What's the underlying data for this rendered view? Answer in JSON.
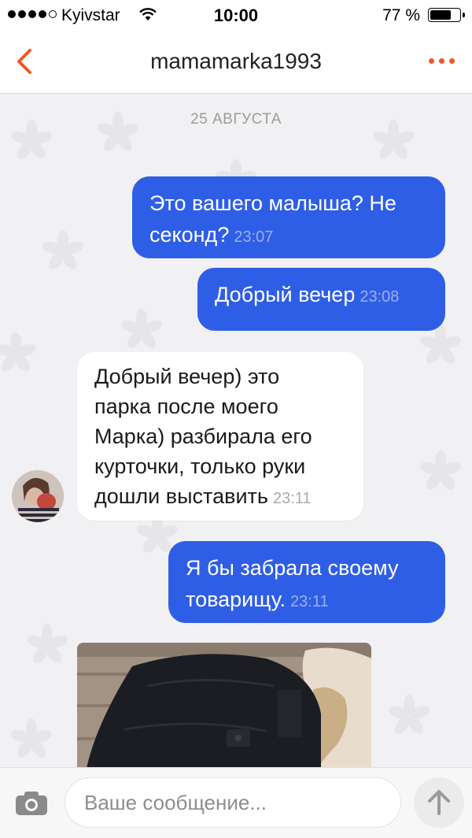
{
  "status_bar": {
    "carrier": "Kyivstar",
    "time": "10:00",
    "battery_percent": "77 %",
    "battery_level": 0.77
  },
  "header": {
    "title": "mamamarka1993",
    "back_icon": "chevron-left-icon",
    "more_icon": "more-dots-icon",
    "accent_color": "#f05a22"
  },
  "chat": {
    "date_separator": "25 АВГУСТА",
    "messages": [
      {
        "direction": "out",
        "lines": [
          "Это вашего малыша? Не",
          "секонд?"
        ],
        "time": "23:07"
      },
      {
        "direction": "out",
        "lines": [
          "Добрый вечер"
        ],
        "time": "23:08"
      },
      {
        "direction": "in",
        "lines": [
          "Добрый вечер) это",
          "парка после моего",
          "Марка) разбирала его",
          "курточки, только руки",
          "дошли выставить"
        ],
        "time": "23:11"
      },
      {
        "direction": "out",
        "lines": [
          "Я бы забрала своему",
          "товарищу."
        ],
        "time": "23:11"
      }
    ],
    "outgoing_color": "#2f5ee6"
  },
  "composer": {
    "placeholder": "Ваше сообщение...",
    "camera_icon": "camera-icon",
    "send_icon": "arrow-up-icon"
  }
}
